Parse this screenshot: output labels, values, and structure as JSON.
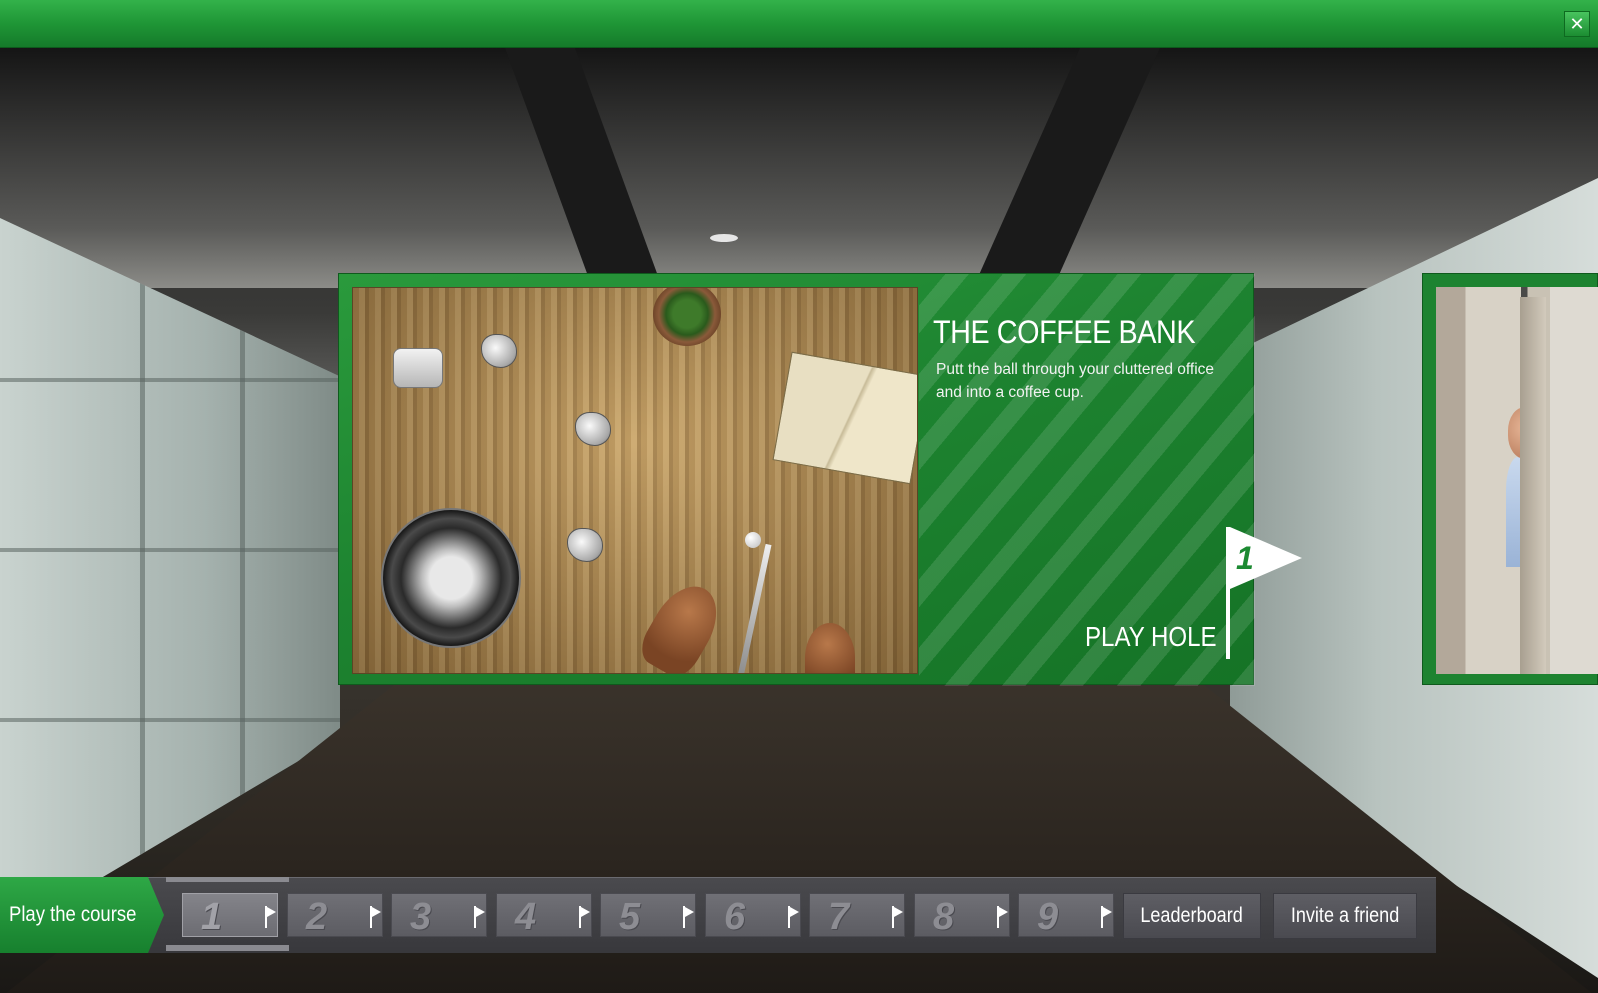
{
  "window": {
    "close_label": "✕"
  },
  "featured_hole": {
    "title": "THE COFFEE BANK",
    "description": "Putt the ball through your cluttered office and into a coffee cup.",
    "play_label": "PLAY HOLE",
    "hole_number": "1"
  },
  "bottom_nav": {
    "play_course_label": "Play the course",
    "holes": [
      {
        "number": "1",
        "active": true
      },
      {
        "number": "2",
        "active": false
      },
      {
        "number": "3",
        "active": false
      },
      {
        "number": "4",
        "active": false
      },
      {
        "number": "5",
        "active": false
      },
      {
        "number": "6",
        "active": false
      },
      {
        "number": "7",
        "active": false
      },
      {
        "number": "8",
        "active": false
      },
      {
        "number": "9",
        "active": false
      }
    ],
    "leaderboard_label": "Leaderboard",
    "invite_label": "Invite a friend"
  },
  "icons": {
    "close": "close-icon",
    "flag": "flag-icon"
  },
  "colors": {
    "brand_green": "#1d8330",
    "nav_gray": "#4a4a4e"
  }
}
